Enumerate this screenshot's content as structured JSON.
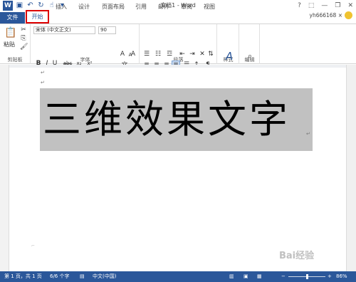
{
  "window": {
    "title": "文档1 - Word",
    "controls": [
      "?",
      "⬚",
      "—",
      "❐",
      "✕"
    ]
  },
  "tabs": [
    {
      "label": "文件"
    },
    {
      "label": "开始"
    },
    {
      "label": "插入"
    },
    {
      "label": "设计"
    },
    {
      "label": "页面布局"
    },
    {
      "label": "引用"
    },
    {
      "label": "邮件"
    },
    {
      "label": "审阅"
    },
    {
      "label": "视图"
    }
  ],
  "user": {
    "name": "yh666168 ×"
  },
  "ribbon": {
    "clipboard": {
      "label": "剪贴板",
      "paste": "粘贴"
    },
    "font": {
      "label": "字体",
      "name": "宋体 (中文正文)",
      "size": "90",
      "bold": "B",
      "italic": "I",
      "underline": "U",
      "strike": "abc",
      "sub": "x₂",
      "sup": "x²",
      "font_color_a": "A",
      "grow": "A",
      "shrink": "A",
      "change_case": "Aa",
      "clear_format": "A"
    },
    "paragraph": {
      "label": "段落"
    },
    "styles": {
      "label": "样式",
      "button": "样式"
    },
    "editing": {
      "label": "编辑",
      "button": "编辑"
    }
  },
  "document": {
    "text": "三维效果文字",
    "para_mark": "↵"
  },
  "statusbar": {
    "page": "第 1 页，共 1 页",
    "words": "6/6 个字",
    "lang": "中文(中国)",
    "zoom": "86%",
    "zoom_level": 0.86
  },
  "watermark": "Bai经验",
  "colors": {
    "accent": "#2b579a",
    "highlight": "#c1c1c1",
    "active_tab_border": "#d00"
  }
}
